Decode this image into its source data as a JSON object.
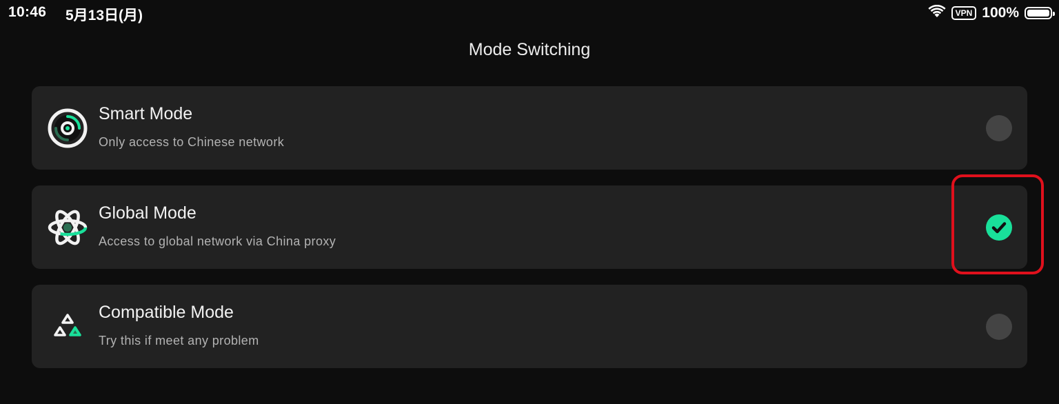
{
  "status_bar": {
    "time": "10:46",
    "date": "5月13日(月)",
    "vpn": "VPN",
    "battery_percent": "100%",
    "icons": [
      "wifi-icon",
      "vpn-badge",
      "battery-icon"
    ]
  },
  "header": {
    "title": "Mode Switching"
  },
  "modes": [
    {
      "title": "Smart Mode",
      "description": "Only access to Chinese network",
      "icon": "smart-mode-icon",
      "selected": false
    },
    {
      "title": "Global Mode",
      "description": "Access to global network via China proxy",
      "icon": "global-mode-icon",
      "selected": true
    },
    {
      "title": "Compatible Mode",
      "description": "Try this if meet any problem",
      "icon": "compatible-mode-icon",
      "selected": false
    }
  ],
  "colors": {
    "background": "#0d0d0d",
    "card": "#222222",
    "accent": "#19e09a",
    "radio_unselected": "#444444",
    "highlight": "#e0101c"
  }
}
